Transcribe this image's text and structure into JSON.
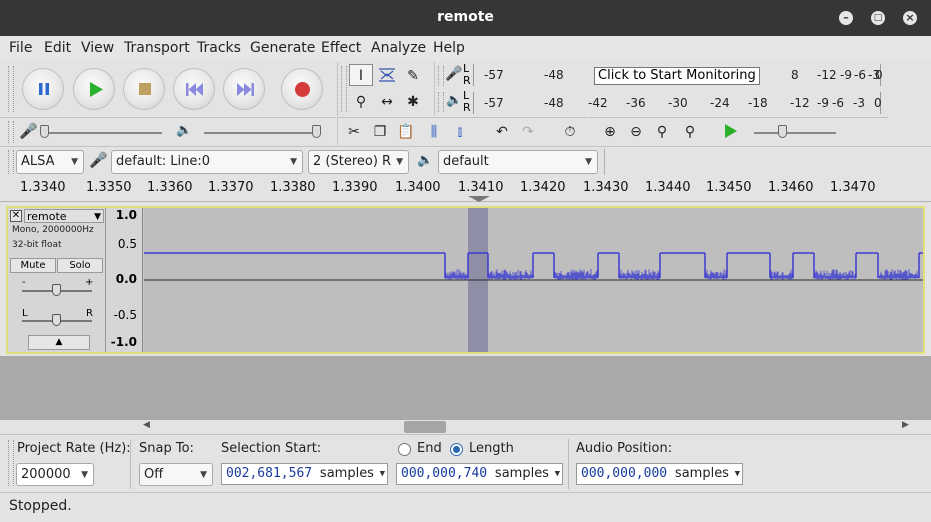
{
  "window": {
    "title": "remote",
    "min_icon": "minimize-icon",
    "max_icon": "maximize-icon",
    "close_icon": "close-icon"
  },
  "menu": [
    "File",
    "Edit",
    "View",
    "Transport",
    "Tracks",
    "Generate",
    "Effect",
    "Analyze",
    "Help"
  ],
  "meters": {
    "record_ticks": [
      "-57",
      "-48",
      "8",
      "-12",
      "-9",
      "-6",
      "-3",
      "0"
    ],
    "monitor_tooltip": "Click to Start Monitoring",
    "play_ticks": [
      "-57",
      "-48",
      "-42",
      "-36",
      "-30",
      "-24",
      "-18",
      "-12",
      "-9",
      "-6",
      "-3",
      "0"
    ],
    "rec_L": "L",
    "rec_R": "R",
    "play_L": "L",
    "play_R": "R"
  },
  "device": {
    "host": "ALSA",
    "recording_device": "default: Line:0",
    "channels": "2 (Stereo) R",
    "playback_device": "default"
  },
  "ruler_ticks": [
    "1.3340",
    "1.3350",
    "1.3360",
    "1.3370",
    "1.3380",
    "1.3390",
    "1.3400",
    "1.3410",
    "1.3420",
    "1.3430",
    "1.3440",
    "1.3450",
    "1.3460",
    "1.3470"
  ],
  "track": {
    "name": "remote",
    "info1": "Mono, 2000000Hz",
    "info2": "32-bit float",
    "mute": "Mute",
    "solo": "Solo",
    "gain_minus": "-",
    "gain_plus": "+",
    "pan_left": "L",
    "pan_right": "R",
    "vruler": [
      "1.0",
      "0.5",
      "0.0",
      "-0.5",
      "-1.0"
    ],
    "wave_color": "#3c3cd0"
  },
  "selection_bar": {
    "project_rate_label": "Project Rate (Hz):",
    "project_rate": "200000",
    "snap_label": "Snap To:",
    "snap_value": "Off",
    "sel_start_label": "Selection Start:",
    "sel_start_value": "002,681,567",
    "samples": "samples",
    "end_label": "End",
    "length_label": "Length",
    "length_value": "000,000,740",
    "audio_pos_label": "Audio Position:",
    "audio_pos_value": "000,000,000"
  },
  "status": "Stopped."
}
